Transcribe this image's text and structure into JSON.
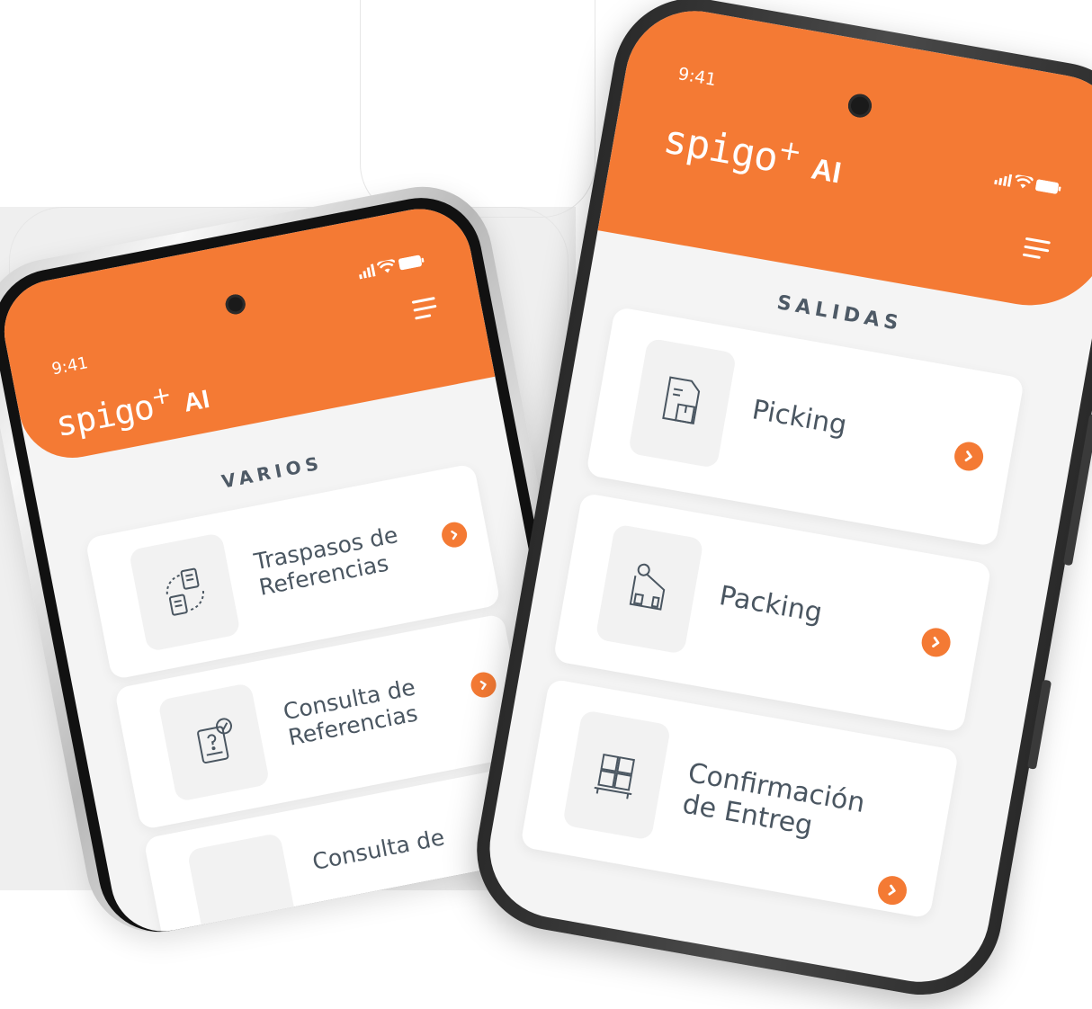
{
  "left_phone": {
    "time": "9:41",
    "logo_main": "sᴝɪɢᴏ⁺",
    "logo_text": "spigo",
    "logo_plus": "+",
    "logo_ai": "AI",
    "section_title": "VARIOS",
    "items": [
      {
        "label_line1": "Traspasos de",
        "label_line2": "Referencias",
        "icon": "transfer-documents-icon"
      },
      {
        "label_line1": "Consulta de",
        "label_line2": "Referencias",
        "icon": "document-question-check-icon"
      },
      {
        "label_line1": "Consulta de",
        "label_line2": "",
        "icon": "document-icon"
      }
    ]
  },
  "right_phone": {
    "time": "9:41",
    "logo_text": "spigo",
    "logo_plus": "+",
    "logo_ai": "AI",
    "section_title": "SALIDAS",
    "items": [
      {
        "label_line1": "Picking",
        "label_line2": "",
        "icon": "picking-document-box-icon"
      },
      {
        "label_line1": "Packing",
        "label_line2": "",
        "icon": "packing-tape-box-icon"
      },
      {
        "label_line1": "Confirmación",
        "label_line2": "de Entreg",
        "icon": "pallet-boxes-icon"
      }
    ]
  },
  "colors": {
    "accent": "#f47a34",
    "text": "#4a5661",
    "screen_bg": "#f4f4f4"
  }
}
